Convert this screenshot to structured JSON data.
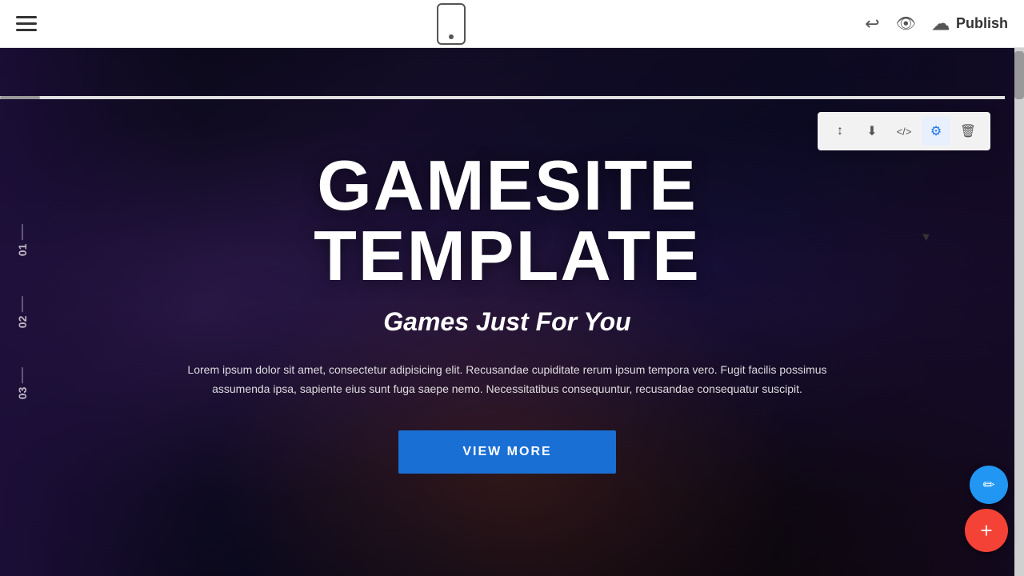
{
  "topbar": {
    "publish_label": "Publish",
    "undo_icon": "↩",
    "mobile_icon_label": "mobile-preview"
  },
  "toolbar": {
    "sort_icon": "↕",
    "download_icon": "⬇",
    "code_icon": "</>",
    "settings_icon": "⚙",
    "delete_icon": "🗑"
  },
  "hero": {
    "title": "GAMESITE TEMPLATE",
    "subtitle": "Games Just For You",
    "description": "Lorem ipsum dolor sit amet, consectetur adipisicing elit. Recusandae cupiditate rerum ipsum tempora vero. Fugit facilis possimus assumenda ipsa, sapiente eius sunt fuga saepe nemo. Necessitatibus consequuntur, recusandae consequatur suscipit.",
    "cta_label": "VIEW MORE",
    "side_numbers": [
      "01",
      "02",
      "03"
    ]
  },
  "fab": {
    "edit_icon": "✏",
    "add_icon": "+"
  }
}
